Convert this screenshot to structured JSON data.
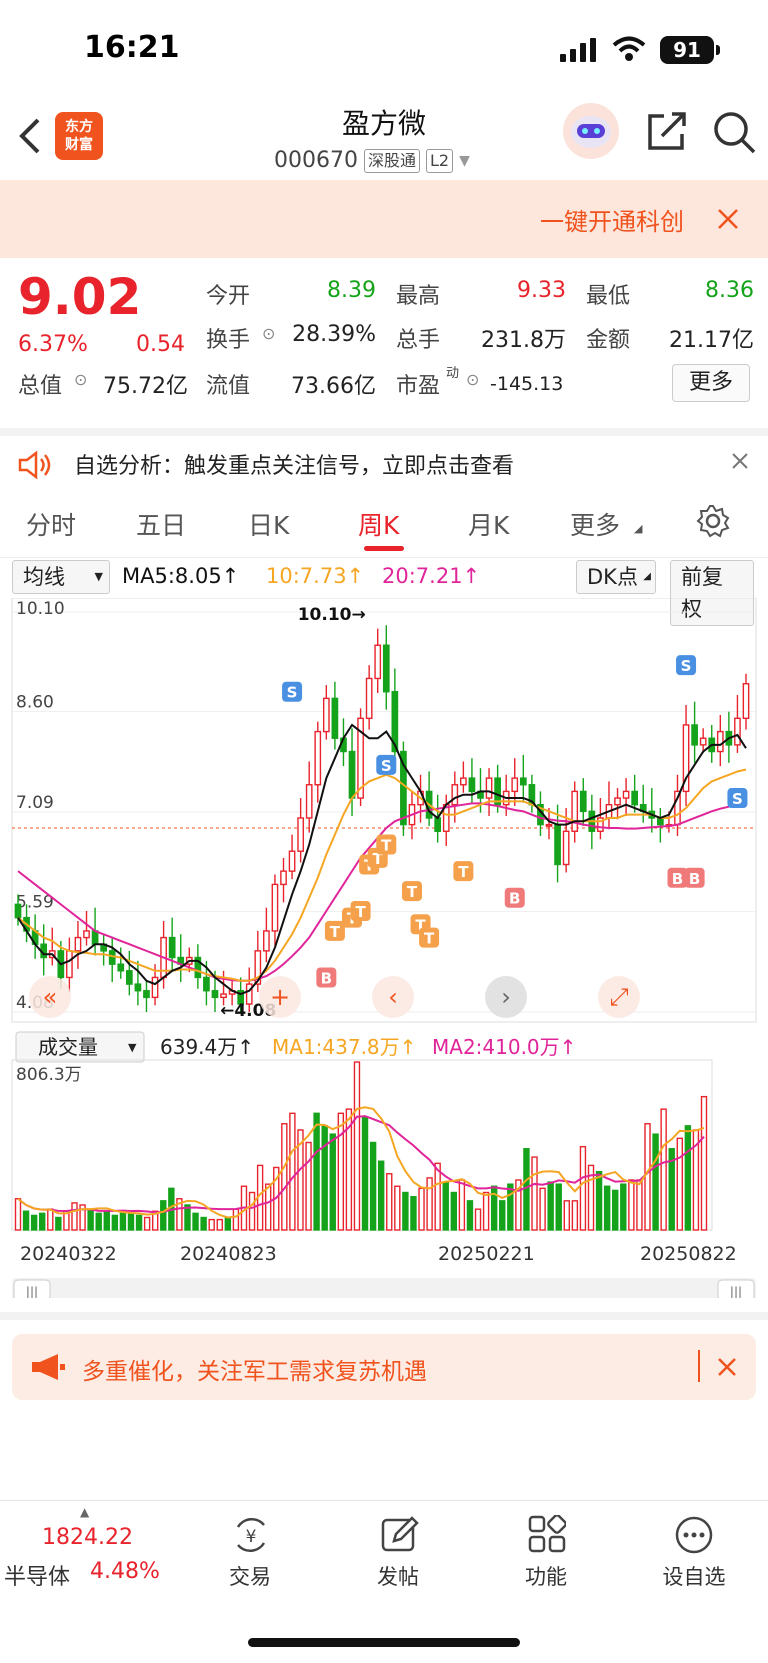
{
  "status": {
    "time": "16:21",
    "battery": "91"
  },
  "header": {
    "logo": [
      "东方",
      "财富"
    ],
    "name": "盈方微",
    "code": "000670",
    "tag1": "深股通",
    "tag2": "L2"
  },
  "banner": {
    "text": "一键开通科创"
  },
  "quote": {
    "price": "9.02",
    "pct": "6.37%",
    "change": "0.54",
    "open_label": "今开",
    "open": "8.39",
    "high_label": "最高",
    "high": "9.33",
    "low_label": "最低",
    "low": "8.36",
    "turnover_label": "换手",
    "turnover": "28.39%",
    "vol_label": "总手",
    "vol": "231.8万",
    "amount_label": "金额",
    "amount": "21.17亿",
    "mktcap_label": "总值",
    "mktcap": "75.72亿",
    "float_label": "流值",
    "float": "73.66亿",
    "pe_label": "市盈",
    "pe_sup": "动",
    "pe": "-145.13",
    "more": "更多"
  },
  "notice": {
    "text": "自选分析：触发重点关注信号，立即点击查看"
  },
  "tabs": [
    "分时",
    "五日",
    "日K",
    "周K",
    "月K",
    "更多"
  ],
  "ma": {
    "select": "均线",
    "ma5": "MA5:8.05↑",
    "ma10": "10:7.73↑",
    "ma20": "20:7.21↑",
    "dk": "DK点",
    "adj": "前复权"
  },
  "colors": {
    "up": "#e8232c",
    "down": "#14a31a",
    "ma5": "#111111",
    "ma10": "#f5a623",
    "ma20": "#e0249a",
    "accent": "#f0531e"
  },
  "chart_data": [
    {
      "type": "candlestick",
      "y_ticks": [
        "10.10",
        "8.60",
        "7.09",
        "5.59",
        "4.08"
      ],
      "ylim": [
        4.08,
        10.1
      ],
      "max_label": "10.10→",
      "min_label": "←4.08",
      "close": [
        5.5,
        5.3,
        5.1,
        4.9,
        5.0,
        4.6,
        5.0,
        5.2,
        5.3,
        5.1,
        5.0,
        4.8,
        4.7,
        4.5,
        4.4,
        4.3,
        4.6,
        5.2,
        4.9,
        4.8,
        4.9,
        4.6,
        4.4,
        4.3,
        4.35,
        4.4,
        4.2,
        4.5,
        5.0,
        5.3,
        6.0,
        6.2,
        6.5,
        7.0,
        7.5,
        8.3,
        8.8,
        8.2,
        8.0,
        7.3,
        8.5,
        9.1,
        9.6,
        8.9,
        8.0,
        6.9,
        7.2,
        7.4,
        7.0,
        6.8,
        7.2,
        7.5,
        7.6,
        7.4,
        7.3,
        7.6,
        7.2,
        7.4,
        7.6,
        7.5,
        7.2,
        6.9,
        6.9,
        6.3,
        6.8,
        7.4,
        7.1,
        6.8,
        7.0,
        7.2,
        7.3,
        7.4,
        7.2,
        7.1,
        7.0,
        6.9,
        6.9,
        7.4,
        8.4,
        8.1,
        8.2,
        8.0,
        8.3,
        8.1,
        8.5,
        9.02
      ],
      "ma5": [
        5.5,
        5.3,
        5.1,
        4.95,
        4.95,
        4.8,
        4.85,
        4.95,
        5.0,
        5.1,
        5.1,
        5.05,
        4.95,
        4.8,
        4.7,
        4.55,
        4.5,
        4.6,
        4.7,
        4.75,
        4.85,
        4.85,
        4.75,
        4.6,
        4.5,
        4.4,
        4.35,
        4.4,
        4.55,
        4.75,
        5.05,
        5.45,
        5.85,
        6.2,
        6.6,
        7.1,
        7.6,
        7.9,
        8.2,
        8.4,
        8.3,
        8.2,
        8.2,
        8.3,
        8.1,
        7.8,
        7.6,
        7.4,
        7.1,
        7.0,
        7.2,
        7.3,
        7.35,
        7.35,
        7.4,
        7.4,
        7.35,
        7.3,
        7.3,
        7.3,
        7.25,
        7.1,
        6.95,
        6.9,
        6.9,
        6.95,
        6.95,
        7.0,
        7.05,
        7.1,
        7.15,
        7.2,
        7.15,
        7.1,
        7.05,
        7.0,
        7.05,
        7.3,
        7.6,
        7.8,
        8.0,
        8.1,
        8.1,
        8.2,
        8.25,
        8.05
      ],
      "ma10": [
        5.5,
        5.4,
        5.3,
        5.2,
        5.15,
        5.05,
        5.0,
        4.98,
        4.97,
        4.95,
        4.95,
        4.92,
        4.9,
        4.85,
        4.8,
        4.75,
        4.7,
        4.7,
        4.7,
        4.72,
        4.72,
        4.7,
        4.65,
        4.62,
        4.6,
        4.58,
        4.55,
        4.55,
        4.6,
        4.7,
        4.85,
        5.05,
        5.25,
        5.5,
        5.8,
        6.1,
        6.45,
        6.75,
        7.05,
        7.3,
        7.45,
        7.55,
        7.6,
        7.65,
        7.6,
        7.5,
        7.4,
        7.3,
        7.2,
        7.1,
        7.05,
        7.05,
        7.1,
        7.15,
        7.2,
        7.25,
        7.25,
        7.25,
        7.25,
        7.25,
        7.2,
        7.15,
        7.1,
        7.05,
        7.0,
        6.95,
        6.95,
        6.95,
        6.95,
        7.0,
        7.0,
        7.05,
        7.05,
        7.05,
        7.05,
        7.0,
        7.0,
        7.05,
        7.15,
        7.3,
        7.45,
        7.55,
        7.6,
        7.65,
        7.7,
        7.73
      ],
      "ma20": [
        6.2,
        6.1,
        6.0,
        5.9,
        5.8,
        5.7,
        5.6,
        5.5,
        5.4,
        5.3,
        5.25,
        5.2,
        5.15,
        5.1,
        5.05,
        5.0,
        4.95,
        4.9,
        4.85,
        4.8,
        4.75,
        4.7,
        4.65,
        4.6,
        4.58,
        4.56,
        4.55,
        4.55,
        4.58,
        4.62,
        4.7,
        4.8,
        4.92,
        5.05,
        5.2,
        5.4,
        5.6,
        5.8,
        6.0,
        6.2,
        6.4,
        6.55,
        6.7,
        6.85,
        6.95,
        7.0,
        7.05,
        7.1,
        7.12,
        7.14,
        7.16,
        7.18,
        7.2,
        7.22,
        7.22,
        7.2,
        7.18,
        7.15,
        7.12,
        7.1,
        7.05,
        7.0,
        6.98,
        6.96,
        6.95,
        6.93,
        6.9,
        6.88,
        6.86,
        6.85,
        6.85,
        6.84,
        6.84,
        6.85,
        6.86,
        6.87,
        6.88,
        6.9,
        6.95,
        7.0,
        7.05,
        7.1,
        7.14,
        7.17,
        7.19,
        7.21
      ],
      "signals": [
        "S",
        "S",
        "S",
        "S",
        "B",
        "B",
        "B",
        "B",
        "B",
        "T",
        "T",
        "T",
        "T",
        "T",
        "T",
        "T",
        "T",
        "T",
        "T"
      ]
    },
    {
      "type": "bar",
      "title": "成交量",
      "latest": "639.4万↑",
      "ma1": "MA1:437.8万↑",
      "ma2": "MA2:410.0万↑",
      "max_label": "806.3万",
      "x_labels": [
        "20240322",
        "20240823",
        "20250221",
        "20250822"
      ],
      "values": [
        150,
        90,
        70,
        80,
        100,
        60,
        90,
        130,
        120,
        100,
        80,
        90,
        70,
        90,
        80,
        70,
        60,
        90,
        140,
        200,
        150,
        120,
        80,
        60,
        50,
        50,
        60,
        100,
        210,
        180,
        310,
        220,
        300,
        510,
        560,
        480,
        420,
        560,
        500,
        460,
        560,
        580,
        806,
        540,
        420,
        330,
        270,
        210,
        180,
        160,
        200,
        250,
        320,
        230,
        180,
        240,
        140,
        100,
        180,
        210,
        140,
        220,
        240,
        390,
        350,
        200,
        230,
        220,
        140,
        140,
        400,
        310,
        280,
        210,
        190,
        220,
        240,
        240,
        510,
        460,
        580,
        390,
        440,
        500,
        480,
        640
      ]
    }
  ],
  "promo": {
    "text": "多重催化，关注军工需求复苏机遇"
  },
  "bottom": {
    "index_value": "1824.22",
    "index_name": "半导体",
    "index_pct": "4.48%",
    "trade": "交易",
    "post": "发帖",
    "func": "功能",
    "watch": "设自选"
  }
}
